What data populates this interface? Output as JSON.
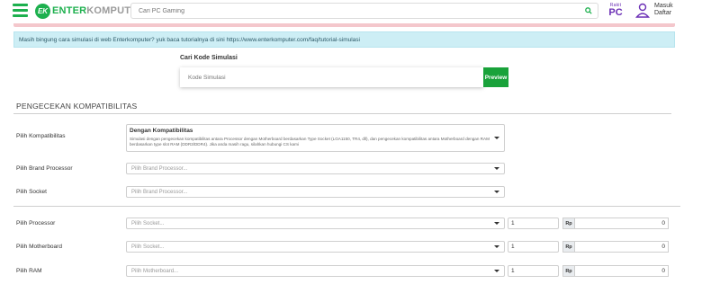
{
  "header": {
    "logo_part1": "ENTER",
    "logo_part2": "KOMPUTER",
    "logo_badge": "EK",
    "search_placeholder": "Cari PC Gaming",
    "rakit_top": "Rakit",
    "rakit_bottom": "PC",
    "masuk": "Masuk",
    "daftar": "Daftar"
  },
  "info_banner": "Masih bingung cara simulasi di web Enterkomputer? yuk baca tutorialnya di sini https://www.enterkomputer.com/faq/tutorial-simulasi",
  "kode": {
    "title": "Cari Kode Simulasi",
    "placeholder": "Kode Simulasi",
    "button": "Preview"
  },
  "section_title": "PENGECEKAN KOMPATIBILITAS",
  "rows": {
    "kompatibilitas": {
      "label": "Pilih Kompatibilitas",
      "title": "Dengan Kompatibilitas",
      "desc": "Simulasi dengan pengecekan kompatibilitas antara Processor dengan Motherboard berdasarkan Type Socket (LGA1150, TR4, dll), dan pengecekan kompatibilitas antara Motherboard dengan RAM berdasarkan type slot RAM (DDR3/DDR4). Jika anda masih ragu, silahkan hubungi CS kami"
    },
    "brand": {
      "label": "Pilih Brand Processor",
      "placeholder": "Pilih Brand Processor..."
    },
    "socket": {
      "label": "Pilih Socket",
      "placeholder": "Pilih Brand Processor..."
    },
    "processor": {
      "label": "Pilih Processor",
      "placeholder": "Pilih Socket...",
      "qty": "1",
      "currency": "Rp",
      "price": "0"
    },
    "motherboard": {
      "label": "Pilih Motherboard",
      "placeholder": "Pilih Socket...",
      "qty": "1",
      "currency": "Rp",
      "price": "0"
    },
    "ram": {
      "label": "Pilih RAM",
      "placeholder": "Pilih Motherboard...",
      "qty": "1",
      "currency": "Rp",
      "price": "0"
    }
  },
  "colors": {
    "brand_green": "#1db04e",
    "preview_green": "#19a23a",
    "rakit_purple": "#6b2fb5",
    "banner_bg": "#cdeef5"
  }
}
